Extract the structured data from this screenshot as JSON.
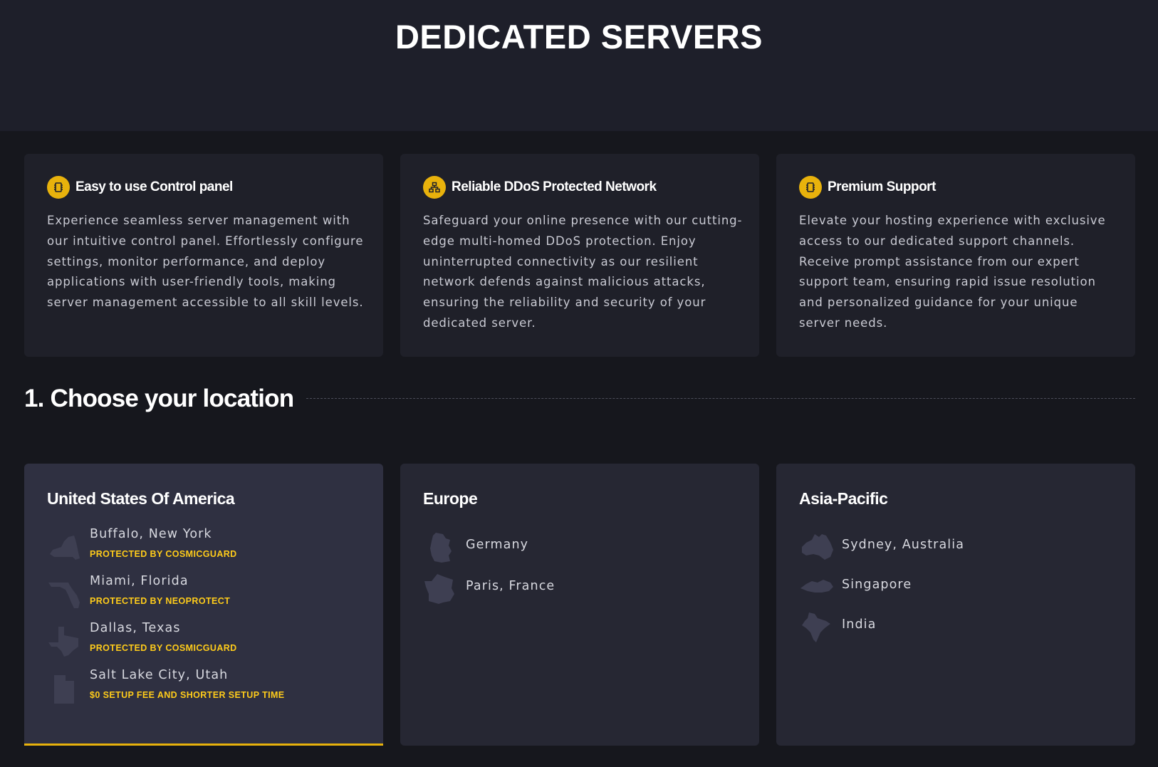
{
  "hero": {
    "title": "DEDICATED SERVERS"
  },
  "features": [
    {
      "icon": "chip-icon",
      "title": "Easy to use Control panel",
      "description": "Experience seamless server management with our intuitive control panel. Effortlessly configure settings, monitor performance, and deploy applications with user-friendly tools, making server management accessible to all skill levels."
    },
    {
      "icon": "network-icon",
      "title": "Reliable DDoS Protected Network",
      "description": "Safeguard your online presence with our cutting-edge multi-homed DDoS protection. Enjoy uninterrupted connectivity as our resilient network defends against malicious attacks, ensuring the reliability and security of your dedicated server."
    },
    {
      "icon": "chip-icon",
      "title": "Premium Support",
      "description": "Elevate your hosting experience with exclusive access to our dedicated support channels. Receive prompt assistance from our expert support team, ensuring rapid issue resolution and personalized guidance for your unique server needs."
    }
  ],
  "location_section": {
    "heading": "1. Choose your location"
  },
  "regions": [
    {
      "title": "United States Of America",
      "selected": true,
      "locations": [
        {
          "name": "Buffalo, New York",
          "badge": "PROTECTED BY COSMICGUARD",
          "icon": "new-york-state-icon"
        },
        {
          "name": "Miami, Florida",
          "badge": "PROTECTED BY NEOPROTECT",
          "icon": "florida-state-icon"
        },
        {
          "name": "Dallas, Texas",
          "badge": "PROTECTED BY COSMICGUARD",
          "icon": "texas-state-icon"
        },
        {
          "name": "Salt Lake City, Utah",
          "badge": "$0 SETUP FEE AND SHORTER SETUP TIME",
          "icon": "utah-state-icon"
        }
      ]
    },
    {
      "title": "Europe",
      "selected": false,
      "locations": [
        {
          "name": "Germany",
          "icon": "germany-map-icon"
        },
        {
          "name": "Paris, France",
          "icon": "france-map-icon"
        }
      ]
    },
    {
      "title": "Asia-Pacific",
      "selected": false,
      "locations": [
        {
          "name": "Sydney, Australia",
          "icon": "australia-map-icon"
        },
        {
          "name": "Singapore",
          "icon": "singapore-map-icon"
        },
        {
          "name": "India",
          "icon": "india-map-icon"
        }
      ]
    }
  ],
  "colors": {
    "accent": "#e8b20c",
    "badge": "#ffcc1a",
    "page_background": "#16171d",
    "hero_background": "#1e1f2a",
    "card_background": "#1f2029",
    "region_background": "#262733",
    "region_selected_background": "#2f3041"
  }
}
